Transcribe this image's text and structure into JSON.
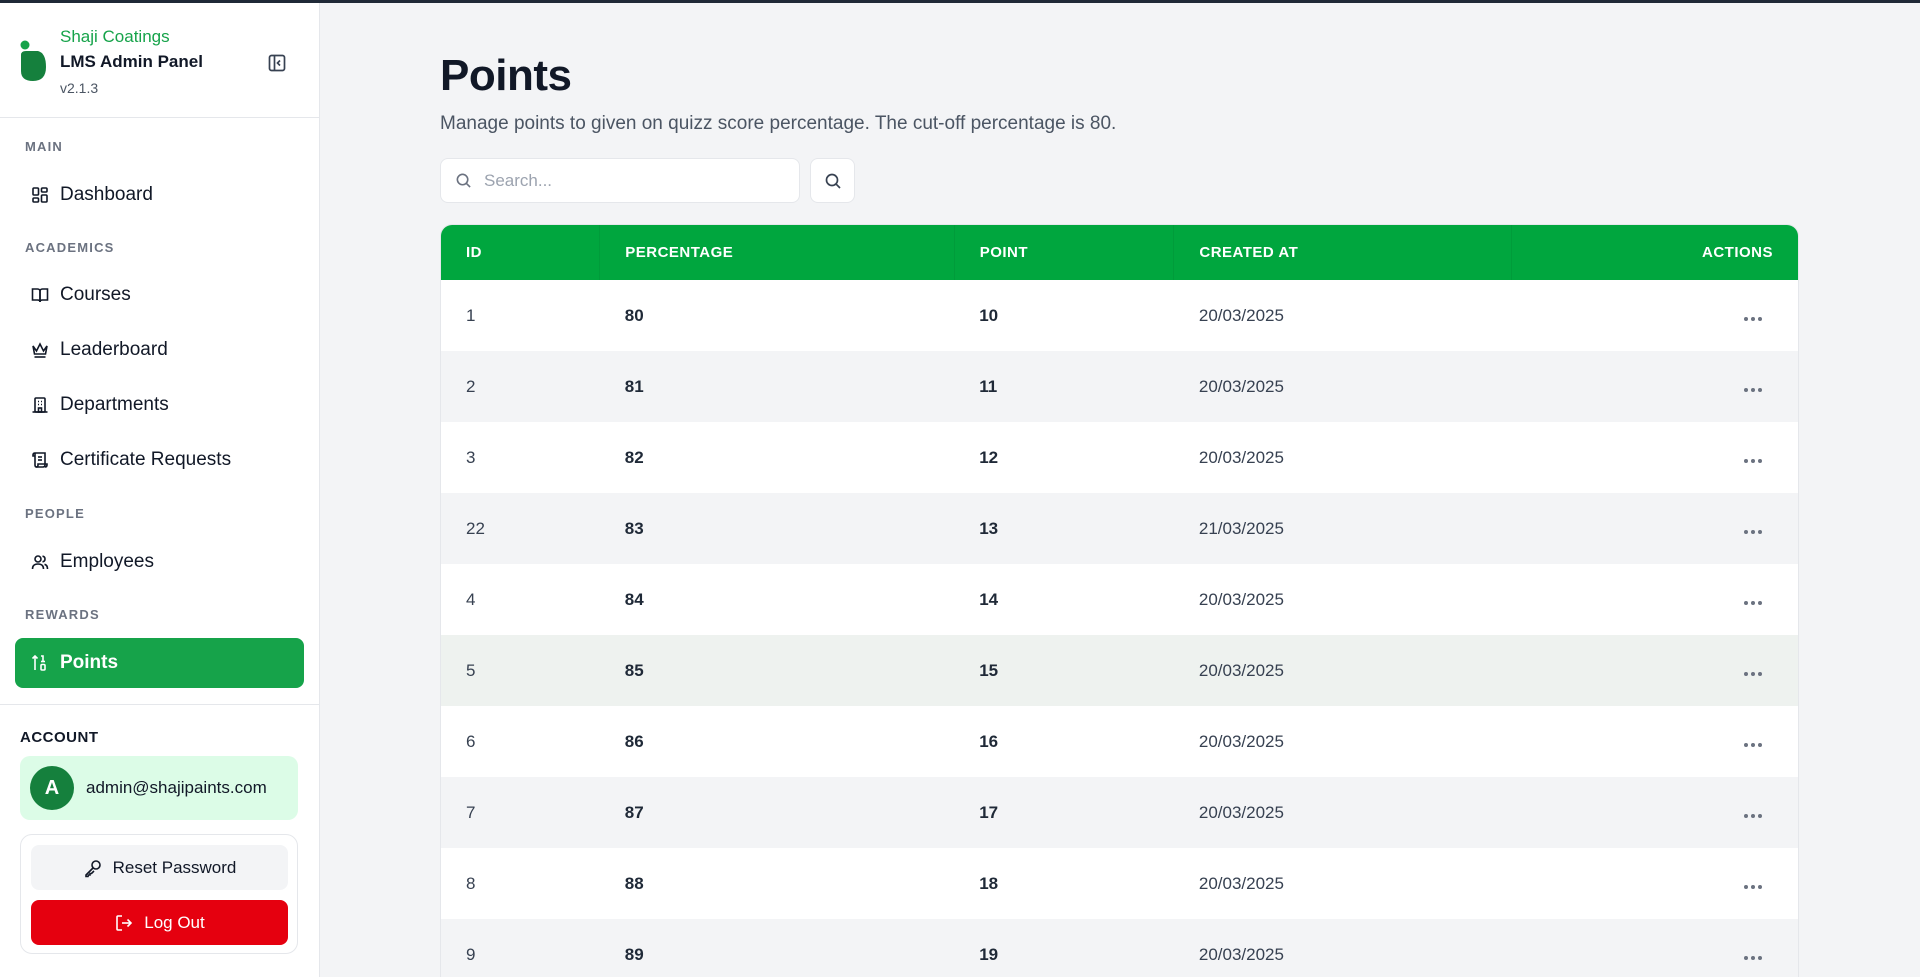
{
  "sidebar": {
    "company": "Shaji Coatings",
    "title": "LMS Admin Panel",
    "version": "v2.1.3",
    "sections": {
      "main": "MAIN",
      "academics": "ACADEMICS",
      "people": "PEOPLE",
      "rewards": "REWARDS"
    },
    "items": {
      "dashboard": "Dashboard",
      "courses": "Courses",
      "leaderboard": "Leaderboard",
      "departments": "Departments",
      "certificate_requests": "Certificate Requests",
      "employees": "Employees",
      "points": "Points"
    },
    "active_item": "points",
    "brand_color": "#16a34a"
  },
  "account": {
    "label": "ACCOUNT",
    "avatar_initial": "A",
    "email": "admin@shajipaints.com",
    "reset_password": "Reset Password",
    "logout": "Log Out"
  },
  "page": {
    "title": "Points",
    "subtitle": "Manage points to given on quizz score percentage. The cut-off percentage is 80."
  },
  "search": {
    "placeholder": "Search...",
    "value": ""
  },
  "table": {
    "headers": {
      "id": "ID",
      "percentage": "PERCENTAGE",
      "point": "POINT",
      "created_at": "CREATED AT",
      "actions": "ACTIONS"
    },
    "header_color": "#00a63e",
    "rows": [
      {
        "id": "1",
        "percentage": "80",
        "point": "10",
        "created_at": "20/03/2025"
      },
      {
        "id": "2",
        "percentage": "81",
        "point": "11",
        "created_at": "20/03/2025"
      },
      {
        "id": "3",
        "percentage": "82",
        "point": "12",
        "created_at": "20/03/2025"
      },
      {
        "id": "22",
        "percentage": "83",
        "point": "13",
        "created_at": "21/03/2025"
      },
      {
        "id": "4",
        "percentage": "84",
        "point": "14",
        "created_at": "20/03/2025"
      },
      {
        "id": "5",
        "percentage": "85",
        "point": "15",
        "created_at": "20/03/2025"
      },
      {
        "id": "6",
        "percentage": "86",
        "point": "16",
        "created_at": "20/03/2025"
      },
      {
        "id": "7",
        "percentage": "87",
        "point": "17",
        "created_at": "20/03/2025"
      },
      {
        "id": "8",
        "percentage": "88",
        "point": "18",
        "created_at": "20/03/2025"
      },
      {
        "id": "9",
        "percentage": "89",
        "point": "19",
        "created_at": "20/03/2025"
      }
    ]
  },
  "colors": {
    "accent": "#16a34a",
    "danger": "#e5000f",
    "user_card_bg": "#dcfce7"
  }
}
